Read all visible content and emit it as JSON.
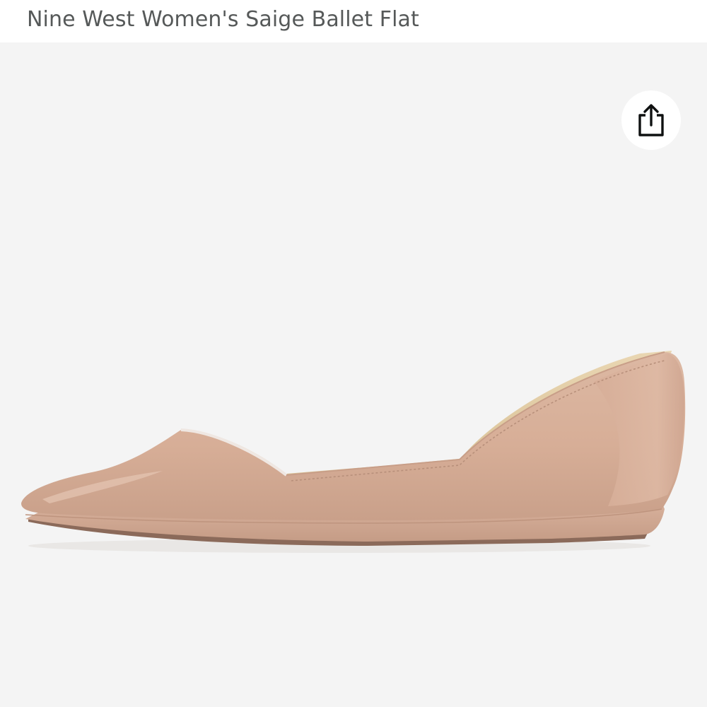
{
  "product": {
    "title": "Nine West Women's Saige Ballet Flat"
  },
  "gallery": {
    "share_icon": "share-icon",
    "image_subject": "product-photo",
    "colors": {
      "background": "#f4f4f4",
      "shoe_upper": "#d9b29c",
      "shoe_lining": "#e6d0a8",
      "sole": "#d2aa94"
    }
  }
}
